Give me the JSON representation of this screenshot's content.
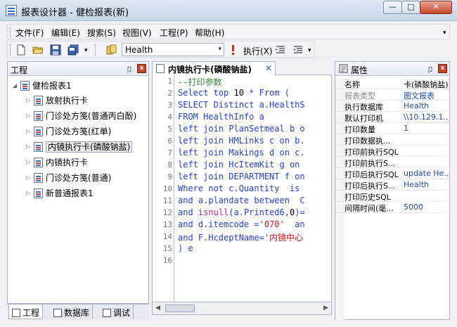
{
  "window": {
    "title": "报表设计器 - 健检报表(新)",
    "min_glyph": "—",
    "max_glyph": "□",
    "close_glyph": "✕"
  },
  "menu": {
    "items": [
      "文件(F)",
      "编辑(E)",
      "搜索(S)",
      "视图(V)",
      "工程(P)",
      "帮助(H)"
    ],
    "overflow_glyph": "▾"
  },
  "toolbar": {
    "icons": [
      "new-file-icon",
      "open-folder-icon",
      "save-icon",
      "save-all-icon",
      "database-icon",
      "execute-icon",
      "indent-icon",
      "outdent-icon"
    ],
    "database": "Health",
    "dropdown_glyph": "▾",
    "execute_label": "执行(X)"
  },
  "project_panel": {
    "title": "工程",
    "pin_glyph": "卩",
    "close_glyph": "x",
    "root": "健检报表1",
    "root_glyph": "◢",
    "expand_glyph": "▷",
    "items": [
      {
        "label": "放射执行卡"
      },
      {
        "label": "门诊处方笺(普通丙白酚)"
      },
      {
        "label": "门诊处方笺(红单)"
      },
      {
        "label": "内镜执行卡(磷酸钠盐)",
        "selected": true
      },
      {
        "label": "内镜执行卡"
      },
      {
        "label": "门诊处方笺(普通)"
      },
      {
        "label": "新普通报表1"
      }
    ],
    "bottom_tabs": [
      "工程",
      "数据库",
      "调试"
    ]
  },
  "editor": {
    "tab_title": "内镜执行卡(磷酸钠盐)",
    "close_glyph": "✕",
    "scroll_left_glyph": "◀",
    "scroll_right_glyph": "▶",
    "line_numbers": [
      "1",
      "2",
      "3",
      "4",
      "5",
      "6",
      "7",
      "8",
      "9",
      "10",
      "11",
      "12",
      "13",
      "14",
      "15",
      "16"
    ],
    "lines": [
      [
        {
          "t": "--打印参数",
          "c": "cm"
        }
      ],
      [
        {
          "t": "Select top ",
          "c": "kw"
        },
        {
          "t": "10",
          "c": "num"
        },
        {
          "t": " * From (",
          "c": "kw"
        }
      ],
      [
        {
          "t": "SELECT Distinct a.HealthS",
          "c": "kw"
        }
      ],
      [
        {
          "t": "FROM HealthInfo a",
          "c": "kw"
        }
      ],
      [
        {
          "t": "left join PlanSetmeal b o",
          "c": "kw"
        }
      ],
      [
        {
          "t": "left join HMLinks c on b.",
          "c": "kw"
        }
      ],
      [
        {
          "t": "left join Makings d on c.",
          "c": "kw"
        }
      ],
      [
        {
          "t": "left join HcItemKit g on ",
          "c": "kw"
        }
      ],
      [
        {
          "t": "left join DEPARTMENT f on",
          "c": "kw"
        }
      ],
      [
        {
          "t": "Where not c.Quantity  is ",
          "c": "kw"
        }
      ],
      [
        {
          "t": "and a.plandate between  C",
          "c": "kw"
        }
      ],
      [
        {
          "t": "and ",
          "c": "kw"
        },
        {
          "t": "isnull",
          "c": "fn"
        },
        {
          "t": "(a.Printed6,",
          "c": "kw"
        },
        {
          "t": "0",
          "c": "num"
        },
        {
          "t": ")=",
          "c": "kw"
        }
      ],
      [
        {
          "t": "and d.itemcode =",
          "c": "kw"
        },
        {
          "t": "'070'",
          "c": "str"
        },
        {
          "t": "  an",
          "c": "kw"
        }
      ],
      [
        {
          "t": "and F.HcdeptName=",
          "c": "kw"
        },
        {
          "t": "'内镜中心",
          "c": "str"
        }
      ],
      [
        {
          "t": ") e",
          "c": "kw"
        }
      ],
      [
        {
          "t": "",
          "c": "kw"
        }
      ]
    ]
  },
  "properties_panel": {
    "title": "属性",
    "pin_glyph": "卩",
    "close_glyph": "x",
    "header": {
      "key": "名称",
      "value": "卡(磷酸钠盐)"
    },
    "rows": [
      {
        "key": "报表类型",
        "value": "图文报表",
        "dim": true
      },
      {
        "key": "执行数据库",
        "value": "Health"
      },
      {
        "key": "默认打印机",
        "value": "\\\\10.129.1..."
      },
      {
        "key": "打印数量",
        "value": "1"
      },
      {
        "key": "打印数据执...",
        "value": ""
      },
      {
        "key": "打印前执行SQL",
        "value": ""
      },
      {
        "key": "打印前执行S...",
        "value": ""
      },
      {
        "key": "打印后执行SQL",
        "value": "update He..."
      },
      {
        "key": "打印后执行S...",
        "value": "Health"
      },
      {
        "key": "打印历史SQL",
        "value": ""
      },
      {
        "key": "间隔时间(毫...",
        "value": "5000"
      }
    ]
  },
  "colors": {
    "keyword": "#1f3fd4",
    "comment": "#2e8b2e",
    "function": "#c0208c",
    "string": "#d0101a",
    "property_value": "#1a4aa8"
  }
}
